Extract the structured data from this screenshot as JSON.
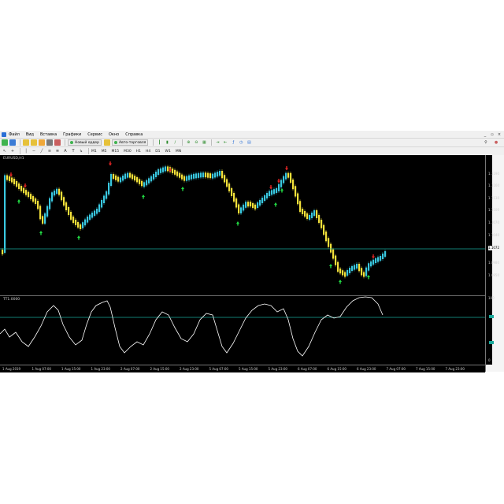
{
  "menu": [
    "Файл",
    "Вид",
    "Вставка",
    "Графики",
    "Сервис",
    "Окно",
    "Справка"
  ],
  "toolbar": {
    "new_order_label": "Новый ордер",
    "auto_trading_label": "Авто-торговля",
    "timeframes": [
      "M1",
      "M5",
      "M15",
      "M30",
      "H1",
      "H4",
      "D1",
      "W1",
      "MN"
    ]
  },
  "chart": {
    "symbol_label": "EURUSD,H1",
    "current_price": "1.1072",
    "price_ticks": [
      "1.1190",
      "1.1160",
      "1.1130",
      "1.1100",
      "1.1070",
      "1.1040",
      "1.1010",
      "1.0980",
      "1.0950"
    ]
  },
  "oscillator": {
    "label": "TT1.0000",
    "ticks": [
      "100",
      "50",
      "0"
    ]
  },
  "time_axis": [
    "1 Aug 2019",
    "1 Aug 07:00",
    "1 Aug 15:00",
    "1 Aug 23:00",
    "2 Aug 07:00",
    "2 Aug 15:00",
    "2 Aug 23:00",
    "5 Aug 07:00",
    "5 Aug 15:00",
    "5 Aug 23:00",
    "6 Aug 07:00",
    "6 Aug 15:00",
    "6 Aug 23:00",
    "7 Aug 07:00",
    "7 Aug 15:00",
    "7 Aug 23:00"
  ],
  "colors": {
    "background": "#000000",
    "bull_candle": "#39c8e0",
    "bear_candle": "#f3e03a",
    "up_arrow": "#22dd44",
    "down_arrow": "#e02424",
    "level_line": "#19a89a",
    "oscillator_line": "#ffffff"
  }
}
